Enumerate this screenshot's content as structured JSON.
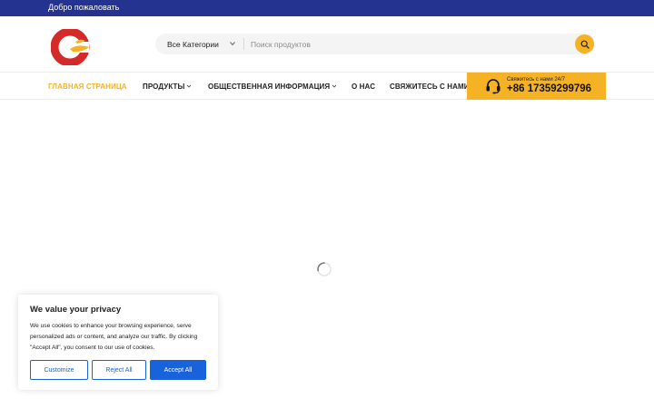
{
  "topbar": {
    "welcome_text": "Добро пожаловать"
  },
  "header": {
    "logo_icon": "brand-logo-icon",
    "search": {
      "category_label": "Все Категории",
      "placeholder": "Поиск продуктов",
      "button_icon": "search-icon"
    }
  },
  "nav": {
    "items": [
      {
        "label": "ГЛАВНАЯ СТРАНИЦА",
        "active": true,
        "has_dropdown": false
      },
      {
        "label": "ПРОДУКТЫ",
        "active": false,
        "has_dropdown": true
      },
      {
        "label": "ОБЩЕСТВЕННАЯ ИНФОРМАЦИЯ",
        "active": false,
        "has_dropdown": true
      },
      {
        "label": "О НАС",
        "active": false,
        "has_dropdown": false
      },
      {
        "label": "СВЯЖИТЕСЬ С НАМИ",
        "active": false,
        "has_dropdown": false
      }
    ],
    "contact": {
      "icon": "headset-icon",
      "small_text": "Свяжитесь с нами 24/7",
      "phone": "+86 17359299796"
    }
  },
  "main": {
    "loading_icon": "loading-spinner-icon"
  },
  "cookie_banner": {
    "title": "We value your privacy",
    "text": "We use cookies to enhance your browsing experience, serve personalized ads or content, and analyze our traffic. By clicking \"Accept All\", you consent to our use of cookies.",
    "buttons": {
      "customize": "Customize",
      "reject": "Reject All",
      "accept": "Accept All"
    }
  },
  "colors": {
    "topbar_bg": "#23338f",
    "accent": "#f5b224",
    "logo_red": "#d42a2a",
    "cookie_blue": "#1863dc"
  }
}
